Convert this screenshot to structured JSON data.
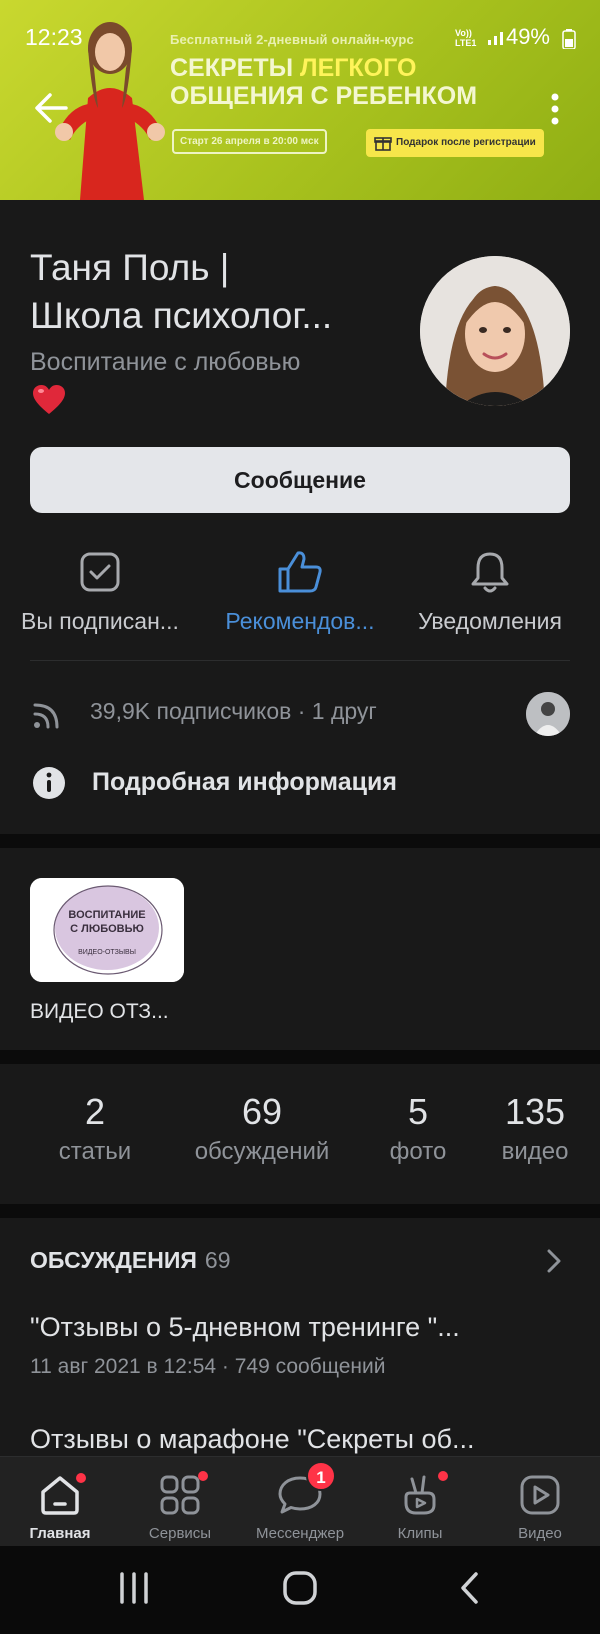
{
  "status_bar": {
    "time": "12:23",
    "battery": "49%",
    "net_top": "Vo))",
    "net_bottom": "LTE1"
  },
  "cover": {
    "top_line": "Бесплатный  2-дневный онлайн-курс",
    "headline_part1": "СЕКРЕТЫ ",
    "headline_accent": "ЛЕГКОГО",
    "headline_line2": "ОБЩЕНИЯ С РЕБЕНКОМ",
    "start_label": "Старт 26 апреля в 20:00 мск",
    "gift_label": "Подарок после регистрации"
  },
  "header": {
    "title_line1": "Таня Поль |",
    "title_line2": "Школа психолог...",
    "status": "Воспитание с любовью"
  },
  "message_button": "Сообщение",
  "actions": [
    {
      "label": "Вы подписан..."
    },
    {
      "label": "Рекомендов..."
    },
    {
      "label": "Уведомления"
    }
  ],
  "subscribers": "39,9K подписчиков · 1 друг",
  "info_label": "Подробная информация",
  "album": {
    "card_line1": "ВОСПИТАНИЕ",
    "card_line2": "С ЛЮБОВЬЮ",
    "card_line3": "ВИДЕО-ОТЗЫВЫ",
    "label": "ВИДЕО ОТЗ..."
  },
  "counters": [
    {
      "num": "2",
      "cap": "статьи"
    },
    {
      "num": "69",
      "cap": "обсуждений"
    },
    {
      "num": "5",
      "cap": "фото"
    },
    {
      "num": "135",
      "cap": "видео"
    }
  ],
  "discussions": {
    "title": "ОБСУЖДЕНИЯ",
    "count": "69",
    "topics": [
      {
        "title": "\"Отзывы о 5-дневном тренинге \"...",
        "meta": "11 авг 2021 в 12:54 · 749 сообщений"
      },
      {
        "title": "Отзывы о марафоне \"Секреты об...",
        "meta": ""
      }
    ]
  },
  "bottom_nav": [
    {
      "label": "Главная"
    },
    {
      "label": "Сервисы"
    },
    {
      "label": "Мессенджер",
      "badge": "1"
    },
    {
      "label": "Клипы"
    },
    {
      "label": "Видео"
    }
  ],
  "colors": {
    "accent_blue": "#4a8fd9",
    "badge_red": "#ff3347",
    "background": "#191919"
  }
}
